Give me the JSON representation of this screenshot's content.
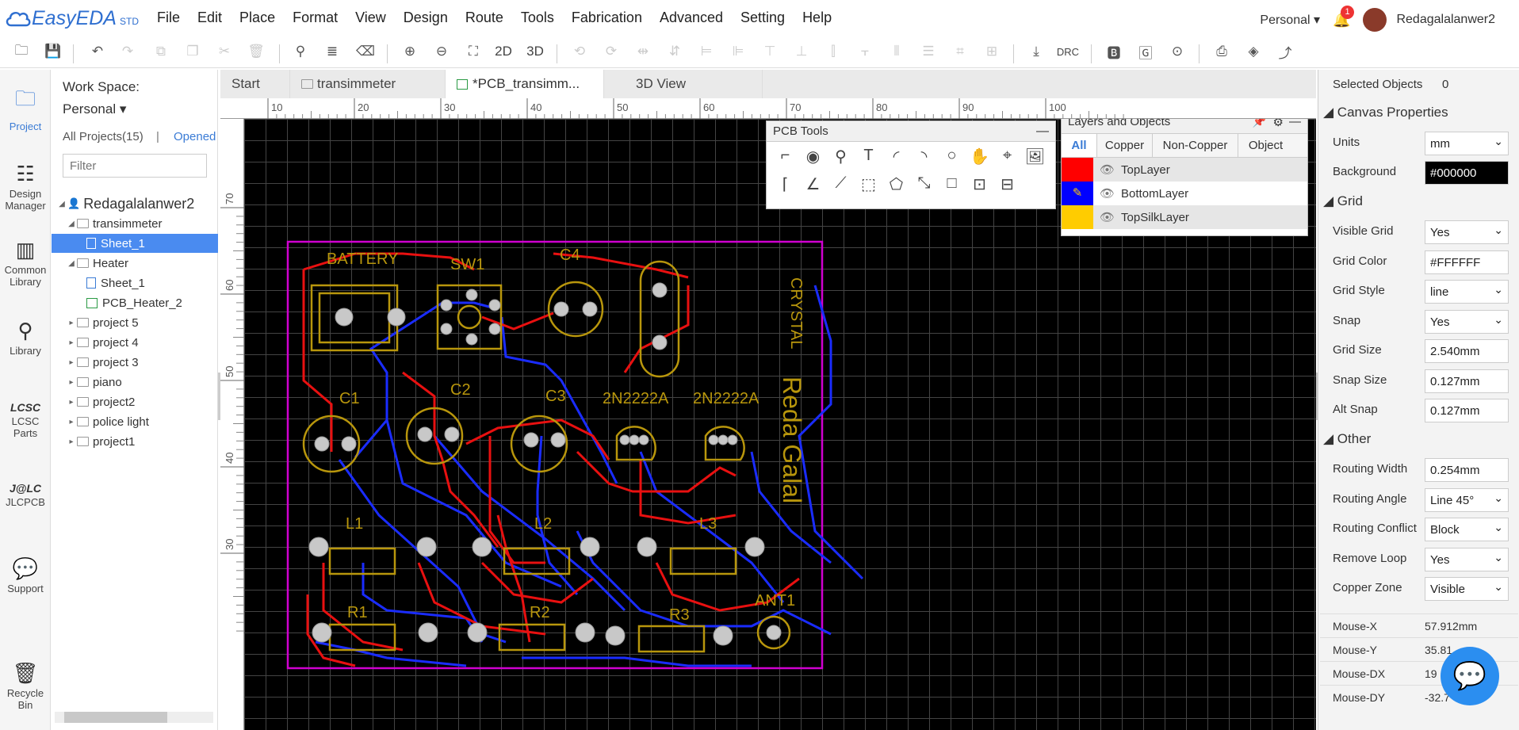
{
  "app": {
    "logo": "EasyEDA",
    "edition": "STD"
  },
  "menu": [
    "File",
    "Edit",
    "Place",
    "Format",
    "View",
    "Design",
    "Route",
    "Tools",
    "Fabrication",
    "Advanced",
    "Setting",
    "Help"
  ],
  "user": {
    "workspace": "Personal",
    "notifications": "1",
    "name": "Redagalalanwer2"
  },
  "toolbar": {
    "label_2d": "2D",
    "label_3d": "3D",
    "label_drc": "DRC"
  },
  "leftnav": [
    "Project",
    "Design Manager",
    "Common Library",
    "Library",
    "LCSC Parts",
    "JLCPCB",
    "Support",
    "Recycle Bin"
  ],
  "project": {
    "workspace_label": "Work Space:",
    "workspace_value": "Personal",
    "all_projects": "All Projects(15)",
    "opened": "Opened",
    "filter_placeholder": "Filter",
    "tree": [
      {
        "label": "Redagalalanwer2",
        "level": 0,
        "type": "user"
      },
      {
        "label": "transimmeter",
        "level": 1,
        "type": "folder",
        "open": true
      },
      {
        "label": "Sheet_1",
        "level": 2,
        "type": "doc",
        "selected": true
      },
      {
        "label": "Heater",
        "level": 1,
        "type": "folder",
        "open": true
      },
      {
        "label": "Sheet_1",
        "level": 2,
        "type": "doc"
      },
      {
        "label": "PCB_Heater_2",
        "level": 2,
        "type": "pcb"
      },
      {
        "label": "project 5",
        "level": 1,
        "type": "folder"
      },
      {
        "label": "project 4",
        "level": 1,
        "type": "folder"
      },
      {
        "label": "project 3",
        "level": 1,
        "type": "folder"
      },
      {
        "label": "piano",
        "level": 1,
        "type": "folder"
      },
      {
        "label": "project2",
        "level": 1,
        "type": "folder"
      },
      {
        "label": "police light",
        "level": 1,
        "type": "folder"
      },
      {
        "label": "project1",
        "level": 1,
        "type": "folder"
      }
    ]
  },
  "tabs": [
    "Start",
    "transimmeter",
    "*PCB_transimm...",
    "3D View"
  ],
  "ruler_h": [
    "10",
    "20",
    "30",
    "40",
    "50",
    "60",
    "70",
    "80",
    "90",
    "100"
  ],
  "ruler_v": [
    "70",
    "60",
    "50",
    "40",
    "30"
  ],
  "pcb_tools": {
    "title": "PCB Tools"
  },
  "layers": {
    "title": "Layers and Objects",
    "tabs": [
      "All",
      "Copper",
      "Non-Copper",
      "Object"
    ],
    "rows": [
      {
        "name": "TopLayer",
        "color": "#ff0000"
      },
      {
        "name": "BottomLayer",
        "color": "#0000ff"
      },
      {
        "name": "TopSilkLayer",
        "color": "#ffcc00"
      }
    ]
  },
  "board": {
    "labels": [
      "BATTERY",
      "SW1",
      "C4",
      "CRYSTAL",
      "C1",
      "C2",
      "C3",
      "2N2222A",
      "2N2222A",
      "Reda Galal",
      "L1",
      "L2",
      "L3",
      "R1",
      "R2",
      "R3",
      "ANT1"
    ]
  },
  "properties": {
    "selected_label": "Selected Objects",
    "selected_count": "0",
    "canvas_title": "Canvas Properties",
    "units_label": "Units",
    "units": "mm",
    "background_label": "Background",
    "background": "#000000",
    "grid_title": "Grid",
    "visible_grid_label": "Visible Grid",
    "visible_grid": "Yes",
    "grid_color_label": "Grid Color",
    "grid_color": "#FFFFFF",
    "grid_style_label": "Grid Style",
    "grid_style": "line",
    "snap_label": "Snap",
    "snap": "Yes",
    "grid_size_label": "Grid Size",
    "grid_size": "2.540mm",
    "snap_size_label": "Snap Size",
    "snap_size": "0.127mm",
    "alt_snap_label": "Alt Snap",
    "alt_snap": "0.127mm",
    "other_title": "Other",
    "routing_width_label": "Routing Width",
    "routing_width": "0.254mm",
    "routing_angle_label": "Routing Angle",
    "routing_angle": "Line 45°",
    "routing_conflict_label": "Routing Conflict",
    "routing_conflict": "Block",
    "remove_loop_label": "Remove Loop",
    "remove_loop": "Yes",
    "copper_zone_label": "Copper Zone",
    "copper_zone": "Visible",
    "mouse": [
      {
        "label": "Mouse-X",
        "value": "57.912mm"
      },
      {
        "label": "Mouse-Y",
        "value": "35.81"
      },
      {
        "label": "Mouse-DX",
        "value": "19"
      },
      {
        "label": "Mouse-DY",
        "value": "-32.7"
      }
    ]
  }
}
